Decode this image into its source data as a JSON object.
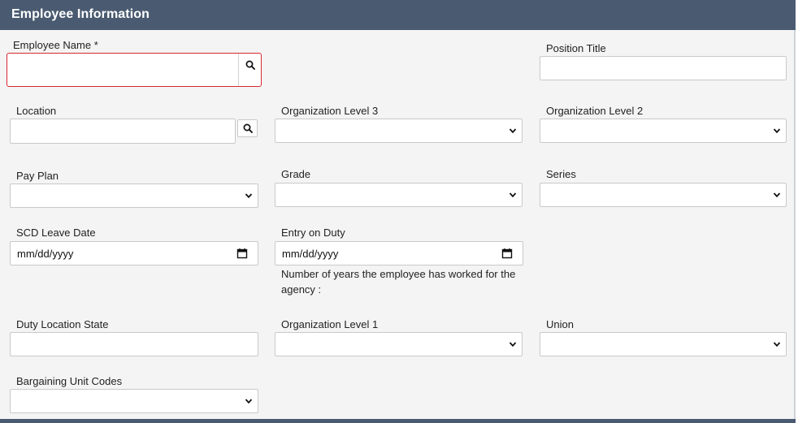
{
  "section": {
    "title": "Employee Information"
  },
  "fields": {
    "employee_name": {
      "label": "Employee Name *",
      "value": ""
    },
    "position_title": {
      "label": "Position Title",
      "value": ""
    },
    "location": {
      "label": "Location",
      "value": ""
    },
    "org_level_3": {
      "label": "Organization Level 3",
      "selected": ""
    },
    "org_level_2": {
      "label": "Organization Level 2",
      "selected": ""
    },
    "pay_plan": {
      "label": "Pay Plan",
      "selected": ""
    },
    "grade": {
      "label": "Grade",
      "selected": ""
    },
    "series": {
      "label": "Series",
      "selected": ""
    },
    "scd_leave_date": {
      "label": "SCD Leave Date",
      "placeholder": "mm/dd/yyyy"
    },
    "entry_on_duty": {
      "label": "Entry on Duty",
      "placeholder": "mm/dd/yyyy",
      "help": "Number of years the employee has worked for the agency :"
    },
    "duty_location_state": {
      "label": "Duty Location State",
      "value": ""
    },
    "org_level_1": {
      "label": "Organization Level 1",
      "selected": ""
    },
    "union": {
      "label": "Union",
      "selected": ""
    },
    "bargaining_unit_codes": {
      "label": "Bargaining Unit Codes",
      "selected": ""
    }
  },
  "icons": {
    "search": "search-icon",
    "chevron": "chevron-down-icon",
    "calendar": "calendar-icon"
  },
  "colors": {
    "header_bg": "#4a5b71",
    "panel_bg": "#f4f4f4",
    "required_border": "#d9272e"
  }
}
